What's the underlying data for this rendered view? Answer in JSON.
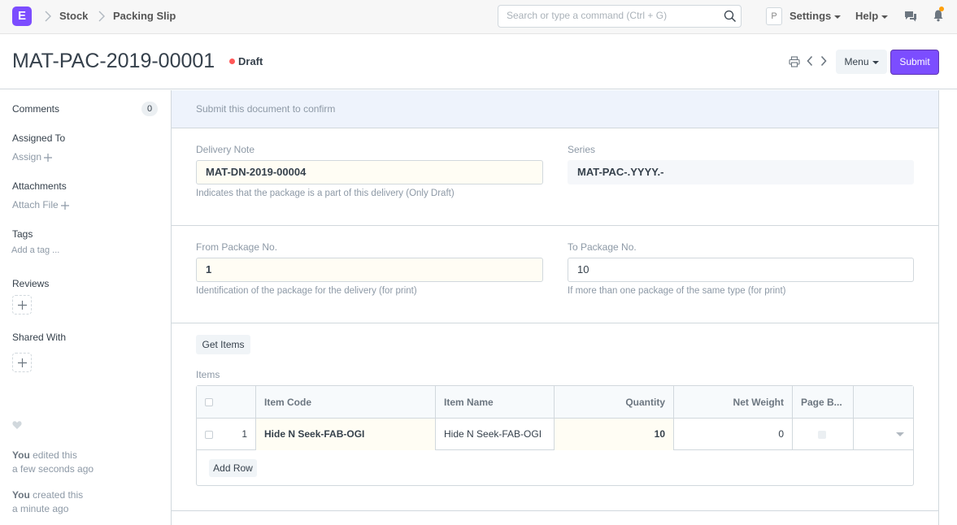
{
  "navbar": {
    "logo_letter": "E",
    "breadcrumbs": [
      "Stock",
      "Packing Slip"
    ],
    "search_placeholder": "Search or type a command (Ctrl + G)",
    "avatar_letter": "P",
    "settings_label": "Settings",
    "help_label": "Help"
  },
  "header": {
    "title": "MAT-PAC-2019-00001",
    "status": "Draft",
    "menu_label": "Menu",
    "submit_label": "Submit"
  },
  "sidebar": {
    "comments_label": "Comments",
    "comments_count": "0",
    "assigned_label": "Assigned To",
    "assign_link": "Assign",
    "attachments_label": "Attachments",
    "attach_link": "Attach File",
    "tags_label": "Tags",
    "add_tag_link": "Add a tag ...",
    "reviews_label": "Reviews",
    "shared_label": "Shared With",
    "activity": [
      {
        "user": "You",
        "action": " edited this",
        "time": "a few seconds ago"
      },
      {
        "user": "You",
        "action": " created this",
        "time": "a minute ago"
      }
    ]
  },
  "form": {
    "alert": "Submit this document to confirm",
    "delivery_note_label": "Delivery Note",
    "delivery_note_value": "MAT-DN-2019-00004",
    "delivery_note_desc": "Indicates that the package is a part of this delivery (Only Draft)",
    "series_label": "Series",
    "series_value": "MAT-PAC-.YYYY.-",
    "from_pkg_label": "From Package No.",
    "from_pkg_value": "1",
    "from_pkg_desc": "Identification of the package for the delivery (for print)",
    "to_pkg_label": "To Package No.",
    "to_pkg_value": "10",
    "to_pkg_desc": "If more than one package of the same type (for print)",
    "get_items_label": "Get Items",
    "items_label": "Items",
    "add_row_label": "Add Row"
  },
  "items_table": {
    "columns": [
      "Item Code",
      "Item Name",
      "Quantity",
      "Net Weight",
      "Page B..."
    ],
    "rows": [
      {
        "idx": "1",
        "item_code": "Hide N Seek-FAB-OGI",
        "item_name": "Hide N Seek-FAB-OGI",
        "quantity": "10",
        "net_weight": "0"
      }
    ]
  },
  "colors": {
    "accent": "#7c4dff",
    "draft_dot": "#ff5858",
    "notification_dot": "#ffa00a"
  }
}
